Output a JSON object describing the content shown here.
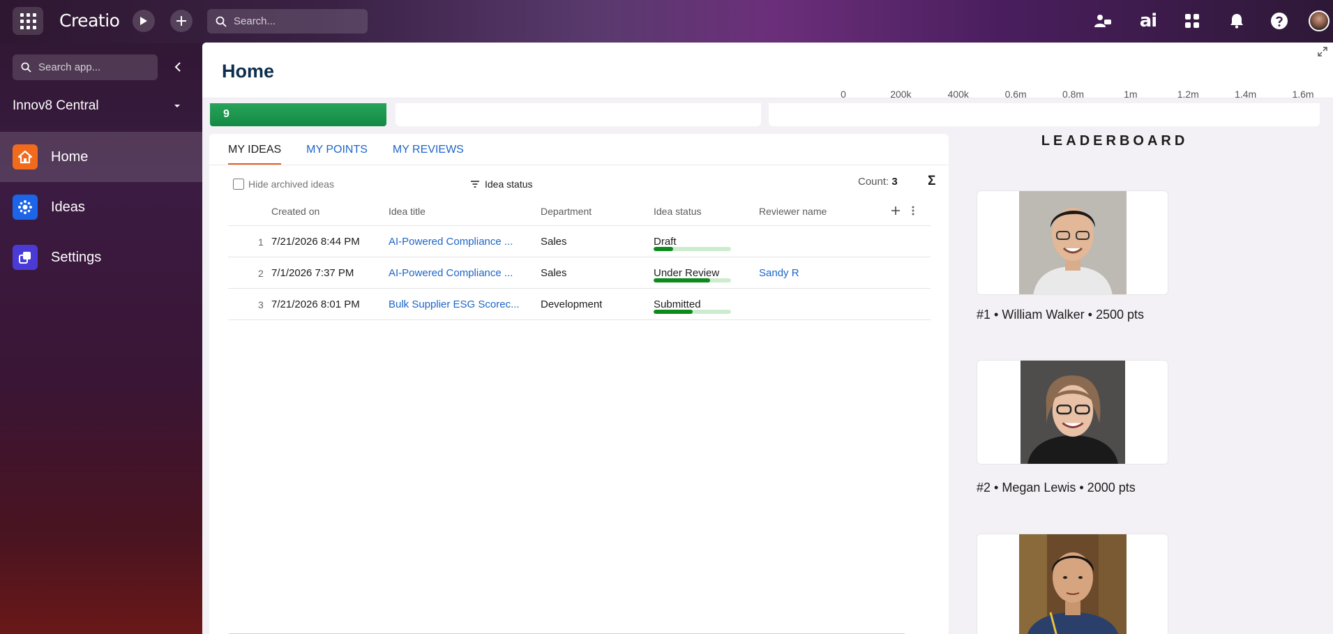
{
  "topbar": {
    "logo": "Creatio",
    "search_placeholder": "Search...",
    "ai_label": "ai"
  },
  "sidebar": {
    "search_placeholder": "Search app...",
    "workspace": "Innov8 Central",
    "items": [
      {
        "label": "Home",
        "icon": "home-icon",
        "color": "#f26b1d",
        "active": true
      },
      {
        "label": "Ideas",
        "icon": "ideas-icon",
        "color": "#1c65e8",
        "active": false
      },
      {
        "label": "Settings",
        "icon": "settings-icon",
        "color": "#4a3bd6",
        "active": false
      }
    ]
  },
  "main": {
    "title": "Home",
    "kpi_value": "9",
    "axis_ticks": [
      "0",
      "200k",
      "400k",
      "0.6m",
      "0.8m",
      "1m",
      "1.2m",
      "1.4m",
      "1.6m"
    ]
  },
  "ideas": {
    "tabs": [
      "MY IDEAS",
      "MY POINTS",
      "MY REVIEWS"
    ],
    "hide_archived_label": "Hide archived ideas",
    "filter_label": "Idea status",
    "count_label": "Count:",
    "count_value": "3",
    "columns": [
      "Created on",
      "Idea title",
      "Department",
      "Idea status",
      "Reviewer name"
    ],
    "rows": [
      {
        "num": "1",
        "created": "7/21/2026 8:44 PM",
        "title": "AI-Powered Compliance ...",
        "department": "Sales",
        "status": "Draft",
        "progress": 0.25,
        "reviewer": ""
      },
      {
        "num": "2",
        "created": "7/1/2026 7:37 PM",
        "title": "AI-Powered Compliance ...",
        "department": "Sales",
        "status": "Under Review",
        "progress": 0.73,
        "reviewer": "Sandy R"
      },
      {
        "num": "3",
        "created": "7/21/2026 8:01 PM",
        "title": "Bulk Supplier ESG Scorec...",
        "department": "Development",
        "status": "Submitted",
        "progress": 0.5,
        "reviewer": ""
      }
    ]
  },
  "leaderboard": {
    "title": "LEADERBOARD",
    "entries": [
      {
        "caption": "#1 • William Walker • 2500 pts"
      },
      {
        "caption": "#2 • Megan Lewis • 2000 pts"
      },
      {
        "caption": ""
      }
    ]
  },
  "colors": {
    "accent_link": "#1c65c8",
    "tab_underline": "#e85d1a",
    "kpi_green": "#1a9a4e",
    "progress_fill": "#0c8a1c"
  }
}
